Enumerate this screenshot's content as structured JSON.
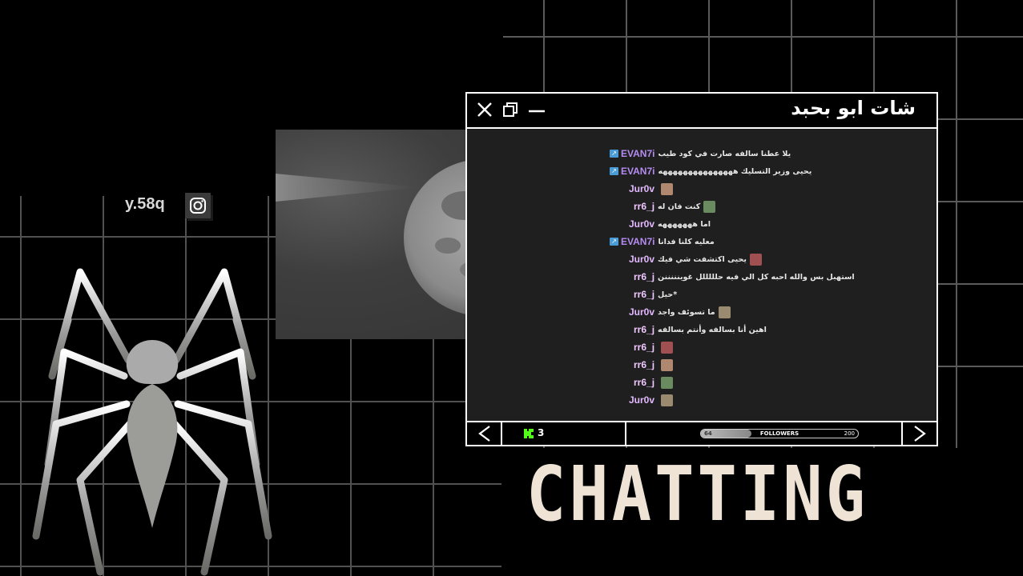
{
  "profile": {
    "handle": "y.58q",
    "icon": "instagram-icon"
  },
  "chat_window": {
    "title": "شات ابو بحبد",
    "controls": [
      "close-icon",
      "restore-icon",
      "minimize-icon"
    ],
    "messages": [
      {
        "user": "EVAN7i",
        "badge": "↗",
        "color": "#b58cf2",
        "text": "يلا عطنا سالفه صارت في كود طيب"
      },
      {
        "user": "EVAN7i",
        "badge": "↗",
        "color": "#b58cf2",
        "text": "يحيى وزير التسليك هههههههههههههههه"
      },
      {
        "user": "Jur0v",
        "badge": "",
        "color": "#e3b8ff",
        "text": ""
      },
      {
        "user": "rr6_j",
        "badge": "",
        "color": "#f0c8ff",
        "text": "كنت فان له"
      },
      {
        "user": "Jur0v",
        "badge": "",
        "color": "#e3b8ff",
        "text": "اما هههههههه"
      },
      {
        "user": "EVAN7i",
        "badge": "↗",
        "color": "#b58cf2",
        "text": "معليه كلنا فدانا"
      },
      {
        "user": "Jur0v",
        "badge": "",
        "color": "#e3b8ff",
        "text": "يحيى اكتشفت شي فيك"
      },
      {
        "user": "rr6_j",
        "badge": "",
        "color": "#f0c8ff",
        "text": "استهبل بس والله احبه كل الي فيه حلللللل غوينننننن"
      },
      {
        "user": "rr6_j",
        "badge": "",
        "color": "#f0c8ff",
        "text": "*حيل"
      },
      {
        "user": "Jur0v",
        "badge": "",
        "color": "#e3b8ff",
        "text": "ما تسوئف واجد"
      },
      {
        "user": "rr6_j",
        "badge": "",
        "color": "#f0c8ff",
        "text": "اهين أنا بسالفه وأنتم بسالفه"
      },
      {
        "user": "rr6_j",
        "badge": "",
        "color": "#f0c8ff",
        "text": ""
      },
      {
        "user": "rr6_j",
        "badge": "",
        "color": "#f0c8ff",
        "text": ""
      },
      {
        "user": "rr6_j",
        "badge": "",
        "color": "#f0c8ff",
        "text": ""
      },
      {
        "user": "Jur0v",
        "badge": "",
        "color": "#e3b8ff",
        "text": ""
      }
    ],
    "footer": {
      "viewers": "3",
      "followers_label": "FOLLOWERS",
      "followers_min": "64",
      "followers_max": "200",
      "followers_progress": 0.32
    }
  },
  "headline": "CHATTING",
  "colors": {
    "accent_green": "#53fc18",
    "cream": "#efe3d6",
    "badge_blue": "#4a9bd6"
  }
}
